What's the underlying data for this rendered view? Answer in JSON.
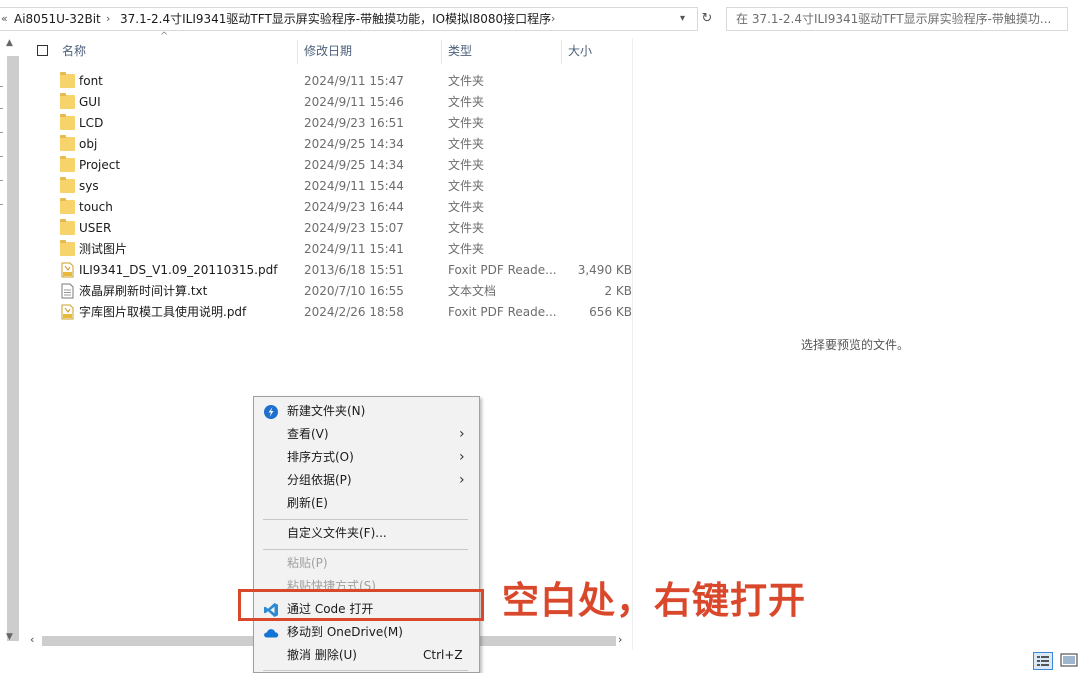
{
  "address": {
    "crumbs": [
      "Ai8051U-32Bit",
      "37.1-2.4寸ILI9341驱动TFT显示屏实验程序-带触摸功能，IO模拟I8080接口程序"
    ],
    "search_placeholder": "在 37.1-2.4寸ILI9341驱动TFT显示屏实验程序-带触摸功..."
  },
  "columns": {
    "name": "名称",
    "date": "修改日期",
    "type": "类型",
    "size": "大小"
  },
  "files": [
    {
      "name": "font",
      "date": "2024/9/11 15:47",
      "type": "文件夹",
      "size": "",
      "kind": "folder"
    },
    {
      "name": "GUI",
      "date": "2024/9/11 15:46",
      "type": "文件夹",
      "size": "",
      "kind": "folder"
    },
    {
      "name": "LCD",
      "date": "2024/9/23 16:51",
      "type": "文件夹",
      "size": "",
      "kind": "folder"
    },
    {
      "name": "obj",
      "date": "2024/9/25 14:34",
      "type": "文件夹",
      "size": "",
      "kind": "folder"
    },
    {
      "name": "Project",
      "date": "2024/9/25 14:34",
      "type": "文件夹",
      "size": "",
      "kind": "folder"
    },
    {
      "name": "sys",
      "date": "2024/9/11 15:44",
      "type": "文件夹",
      "size": "",
      "kind": "folder"
    },
    {
      "name": "touch",
      "date": "2024/9/23 16:44",
      "type": "文件夹",
      "size": "",
      "kind": "folder"
    },
    {
      "name": "USER",
      "date": "2024/9/23 15:07",
      "type": "文件夹",
      "size": "",
      "kind": "folder"
    },
    {
      "name": "测试图片",
      "date": "2024/9/11 15:41",
      "type": "文件夹",
      "size": "",
      "kind": "folder"
    },
    {
      "name": "ILI9341_DS_V1.09_20110315.pdf",
      "date": "2013/6/18 15:51",
      "type": "Foxit PDF Reade...",
      "size": "3,490 KB",
      "kind": "pdf"
    },
    {
      "name": "液晶屏刷新时间计算.txt",
      "date": "2020/7/10 16:55",
      "type": "文本文档",
      "size": "2 KB",
      "kind": "txt"
    },
    {
      "name": "字库图片取模工具使用说明.pdf",
      "date": "2024/2/26 18:58",
      "type": "Foxit PDF Reade...",
      "size": "656 KB",
      "kind": "pdf"
    }
  ],
  "preview_text": "选择要预览的文件。",
  "context_menu": {
    "new_folder": "新建文件夹(N)",
    "view": "查看(V)",
    "sort": "排序方式(O)",
    "group": "分组依据(P)",
    "refresh": "刷新(E)",
    "customize": "自定义文件夹(F)...",
    "paste": "粘贴(P)",
    "paste_shortcut": "粘贴快捷方式(S)",
    "open_code": "通过 Code 打开",
    "move_onedrive": "移动到 OneDrive(M)",
    "undo": "撤消 删除(U)",
    "undo_shortcut": "Ctrl+Z"
  },
  "annotation": "空白处，右键打开",
  "colors": {
    "accent": "#d9482b",
    "folder": "#f7d36b",
    "vscode": "#2a8ad4"
  }
}
